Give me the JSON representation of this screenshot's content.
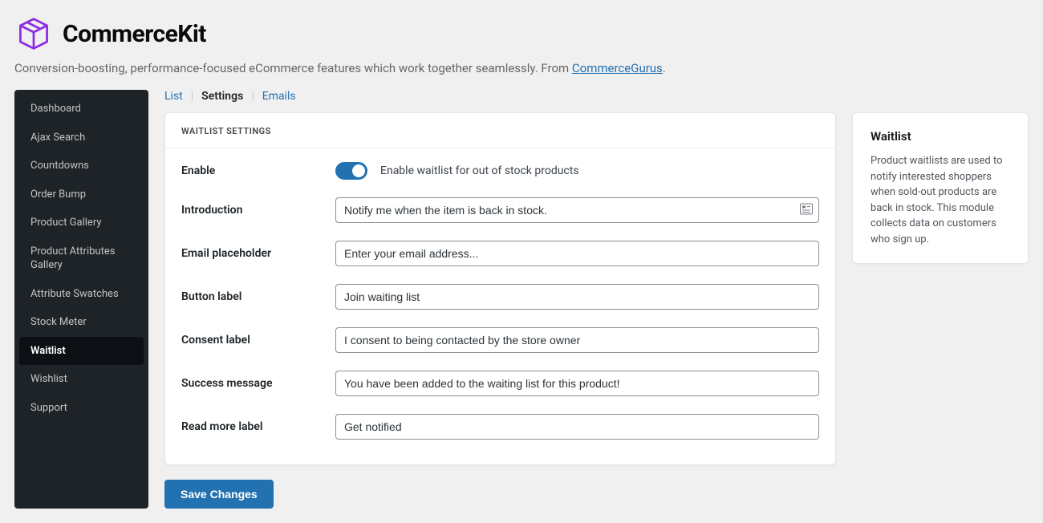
{
  "header": {
    "logo_text": "CommerceKit",
    "tagline_prefix": "Conversion-boosting, performance-focused eCommerce features which work together seamlessly. From ",
    "tagline_link": "CommerceGurus",
    "tagline_suffix": "."
  },
  "sidebar": {
    "items": [
      {
        "label": "Dashboard"
      },
      {
        "label": "Ajax Search"
      },
      {
        "label": "Countdowns"
      },
      {
        "label": "Order Bump"
      },
      {
        "label": "Product Gallery"
      },
      {
        "label": "Product Attributes Gallery"
      },
      {
        "label": "Attribute Swatches"
      },
      {
        "label": "Stock Meter"
      },
      {
        "label": "Waitlist"
      },
      {
        "label": "Wishlist"
      },
      {
        "label": "Support"
      }
    ],
    "active_index": 8
  },
  "tabs": {
    "items": [
      {
        "label": "List"
      },
      {
        "label": "Settings"
      },
      {
        "label": "Emails"
      }
    ],
    "active_index": 1
  },
  "panel": {
    "heading": "WAITLIST SETTINGS",
    "rows": {
      "enable": {
        "label": "Enable",
        "toggle_desc": "Enable waitlist for out of stock products",
        "toggle_on": true
      },
      "introduction": {
        "label": "Introduction",
        "value": "Notify me when the item is back in stock."
      },
      "email_placeholder": {
        "label": "Email placeholder",
        "value": "Enter your email address..."
      },
      "button_label": {
        "label": "Button label",
        "value": "Join waiting list"
      },
      "consent_label": {
        "label": "Consent label",
        "value": "I consent to being contacted by the store owner"
      },
      "success_message": {
        "label": "Success message",
        "value": "You have been added to the waiting list for this product!"
      },
      "read_more_label": {
        "label": "Read more label",
        "value": "Get notified"
      }
    }
  },
  "save_button": "Save Changes",
  "infobox": {
    "title": "Waitlist",
    "body": "Product waitlists are used to notify interested shoppers when sold-out products are back in stock. This module collects data on customers who sign up."
  },
  "colors": {
    "accent": "#2271b1",
    "brand": "#8e2de2"
  }
}
